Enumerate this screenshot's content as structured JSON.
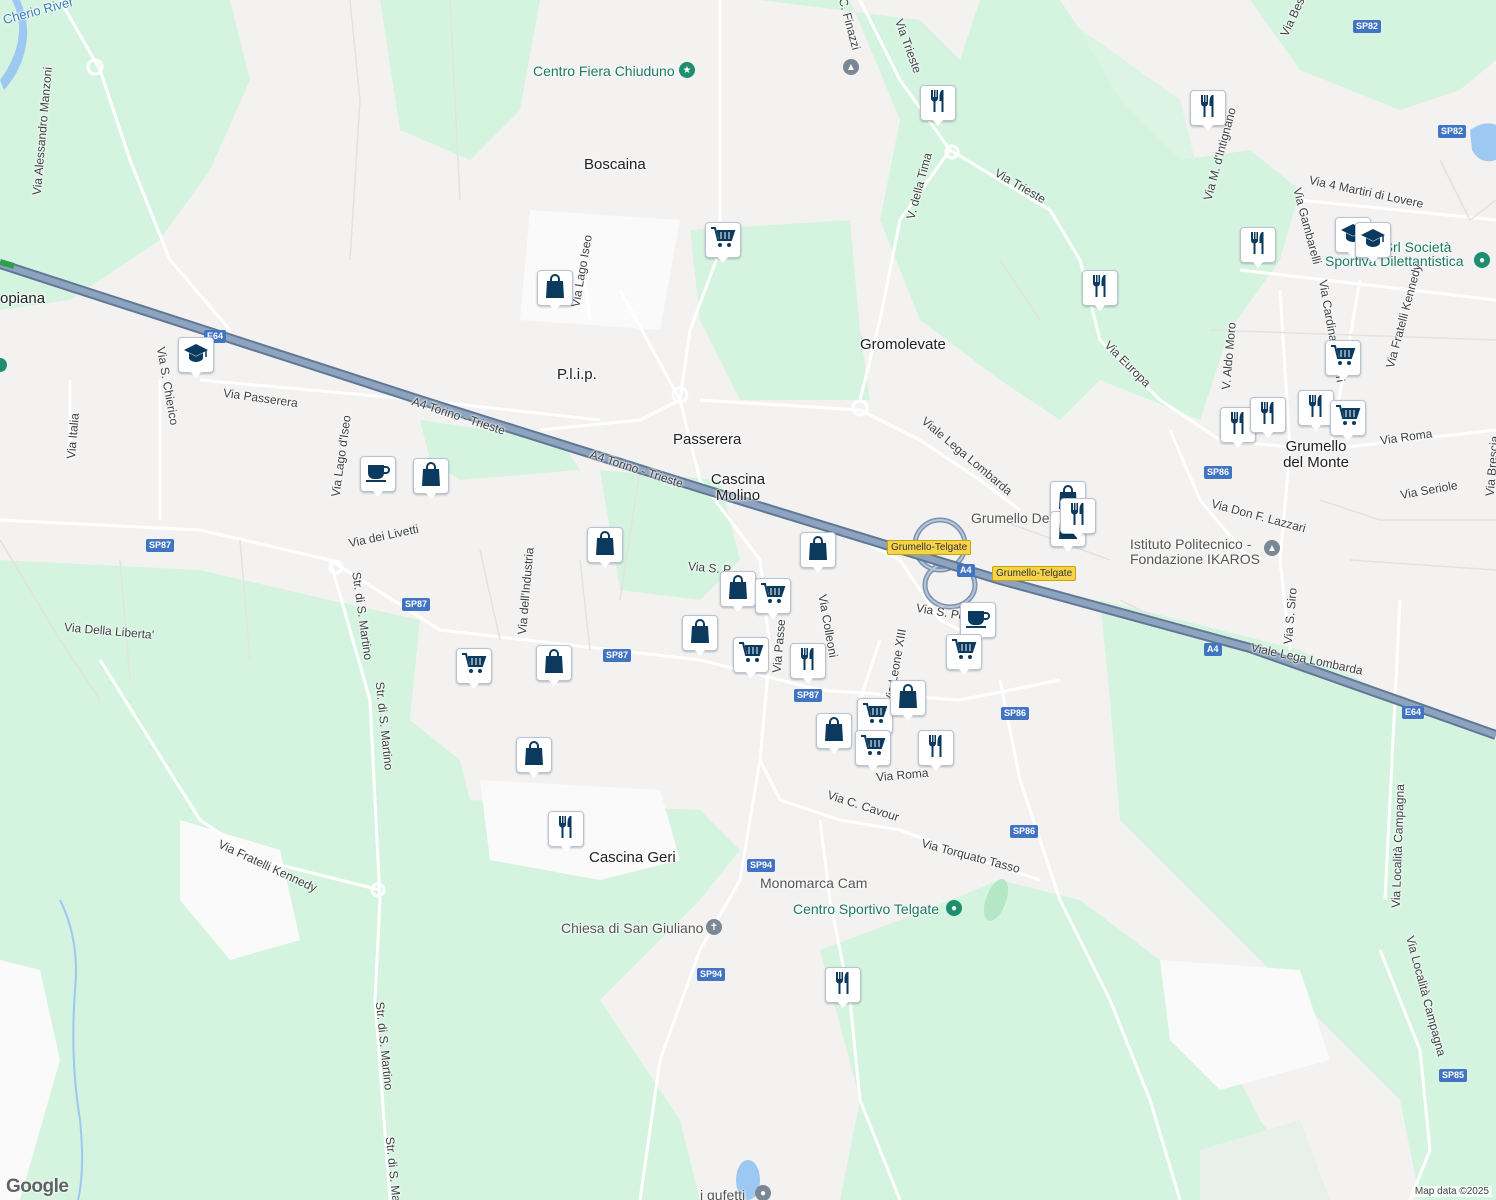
{
  "map": {
    "places": {
      "boscaina": "Boscaina",
      "plip": "P.l.i.p.",
      "passerera": "Passerera",
      "cascina_molino": "Cascina Molino",
      "gromolevate": "Gromolevate",
      "grumello_del_monte": "Grumello del Monte",
      "cascina_geri": "Cascina Geri",
      "topiana": "opiana"
    },
    "pois": {
      "centro_fiera": "Centro Fiera Chiuduno",
      "istituto": "Istituto Politecnico - Fondazione IKAROS",
      "chiesa": "Chiesa di San Giuliano",
      "centro_sportivo": "Centro Sportivo Telgate",
      "monomarca": "Monomarca Cam",
      "grumello_del": "Grumello Del",
      "asd": "o Srl Società",
      "asd2": "Sportiva Dilettantistica",
      "gufetti": "i gufetti"
    },
    "water": {
      "cherio": "Cherio River"
    },
    "roads": {
      "a4_1": "A4 Torino - Trieste",
      "a4_2": "A4 Torino - Trieste",
      "via_passerera": "Via Passerera",
      "via_italia": "Via Italia",
      "via_s_chierico": "Via S. Chierico",
      "via_lago_iseo_1": "Via Lago d'Iseo",
      "via_lago_iseo_2": "Via Lago Iseo",
      "via_livetti": "Via dei Livetti",
      "via_industria": "Via dell'Industria",
      "via_liberta": "Via Della Liberta'",
      "str_martino_1": "Str. di S. Martino",
      "str_martino_2": "Str. di S. Martino",
      "str_martino_3": "Str. di S. Martino",
      "str_martino_4": "Str. di S. Martino",
      "via_kennedy": "Via Fratelli Kennedy",
      "via_manzoni": "Via Alessandro Manzoni",
      "via_s_p": "Via S. P",
      "via_passe": "Via Passe",
      "via_colleoni": "Via Colleoni",
      "via_s_pe": "Via S. Pe",
      "via_leone": "Via Leone XIII",
      "via_roma_t": "Via Roma",
      "via_cavour": "Via C. Cavour",
      "via_tasso": "Via Torquato Tasso",
      "viale_lega_1": "Viale Lega Lombarda",
      "viale_lega_2": "Viale Lega Lombarda",
      "via_trieste_1": "Via Trieste",
      "via_trieste_2": "Via Trieste",
      "via_finazzi": "Via C. Finazzi",
      "v_tima": "V. della Tima",
      "via_europa": "Via Europa",
      "via_intignano": "Via M. d'Intignano",
      "via_4_martiri": "Via 4 Martiri di Lovere",
      "via_gambarelli": "Via Gambarelli",
      "via_ferrari": "Via Cardinal Ferrari",
      "via_kennedy_2": "Via Fratelli Kennedy",
      "via_aldo_moro": "V. Aldo Moro",
      "via_roma_g": "Via Roma",
      "via_seriole": "Via Seriole",
      "via_lazzari": "Via Don F. Lazzari",
      "via_s_siro": "Via S. Siro",
      "via_brescia": "Via Brescia",
      "via_loc_campagna_1": "Via Località Campagna",
      "via_loc_campagna_2": "Via Località Campagna",
      "via_besa": "Via Besa"
    },
    "shields": {
      "sp82a": "SP82",
      "sp82b": "SP82",
      "e64a": "E64",
      "e64b": "E64",
      "sp87a": "SP87",
      "sp87b": "SP87",
      "sp87c": "SP87",
      "sp87d": "SP87",
      "a4a": "A4",
      "a4b": "A4",
      "sp86a": "SP86",
      "sp86b": "SP86",
      "sp86c": "SP86",
      "sp94a": "SP94",
      "sp94b": "SP94",
      "sp85": "SP85",
      "exit1": "Grumello-Telgate",
      "exit2": "Grumello-Telgate"
    },
    "markers": [
      "restaurant-icon",
      "restaurant-icon",
      "shopping-cart-icon",
      "shopping-bag-icon",
      "school-icon",
      "restaurant-icon",
      "school-icon",
      "school-icon",
      "restaurant-icon",
      "shopping-cart-icon",
      "restaurant-icon",
      "restaurant-icon",
      "restaurant-icon",
      "shopping-cart-icon",
      "coffee-icon",
      "shopping-bag-icon",
      "shopping-bag-icon",
      "shopping-bag-icon",
      "shopping-bag-icon",
      "shopping-cart-icon",
      "shopping-bag-icon",
      "shopping-cart-icon",
      "restaurant-icon",
      "coffee-icon",
      "shopping-cart-icon",
      "shopping-cart-icon",
      "shopping-bag-icon",
      "shopping-bag-icon",
      "shopping-bag-icon",
      "shopping-cart-icon",
      "shopping-cart-icon",
      "restaurant-icon",
      "shopping-bag-icon",
      "shopping-bag-icon",
      "restaurant-icon",
      "shopping-bag-icon",
      "restaurant-icon",
      "restaurant-icon"
    ],
    "attribution": "Map data ©2025",
    "logo": "Google",
    "colors": {
      "marker_icon": "#0b3a5e",
      "park": "#d3f5e0",
      "motorway": "#7d93b0",
      "water": "#9cc8f2"
    }
  }
}
